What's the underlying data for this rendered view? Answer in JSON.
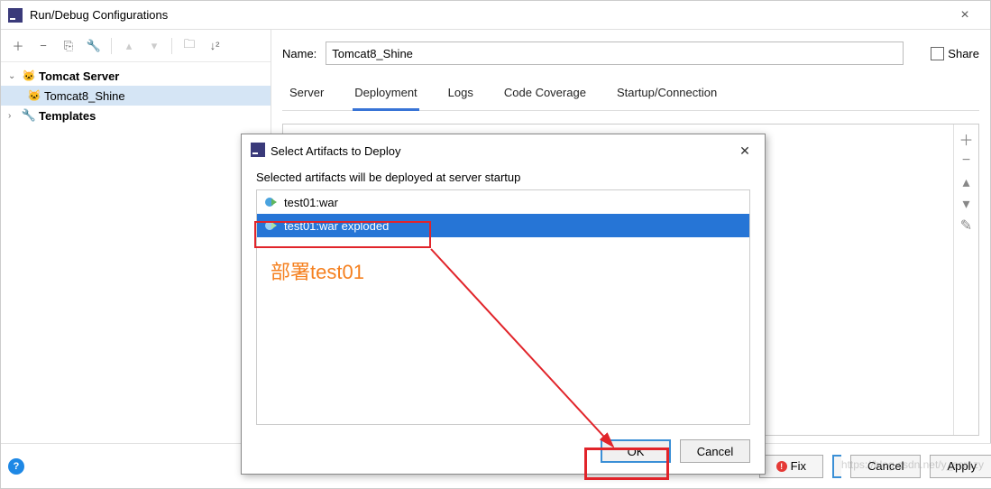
{
  "window": {
    "title": "Run/Debug Configurations"
  },
  "toolbar_icons": [
    "add",
    "remove",
    "copy",
    "wrench",
    "up",
    "down",
    "folder",
    "sort"
  ],
  "tree": {
    "tomcat_server": "Tomcat Server",
    "config_name": "Tomcat8_Shine",
    "templates": "Templates"
  },
  "form": {
    "name_label": "Name:",
    "name_value": "Tomcat8_Shine",
    "share_label": "Share"
  },
  "tabs": {
    "server": "Server",
    "deployment": "Deployment",
    "logs": "Logs",
    "code_coverage": "Code Coverage",
    "startup": "Startup/Connection"
  },
  "side_buttons": [
    "+",
    "−",
    "▲",
    "▼",
    "✎"
  ],
  "bottom": {
    "fix": "Fix",
    "cancel": "Cancel",
    "apply": "Apply"
  },
  "dialog": {
    "title": "Select Artifacts to Deploy",
    "desc": "Selected artifacts will be deployed at server startup",
    "item1": "test01:war",
    "item2": "test01:war exploded",
    "ok": "OK",
    "cancel": "Cancel"
  },
  "annotation": {
    "deploy_text": "部署test01"
  },
  "watermark": "https://blog.csdn.net/y_scrazy"
}
